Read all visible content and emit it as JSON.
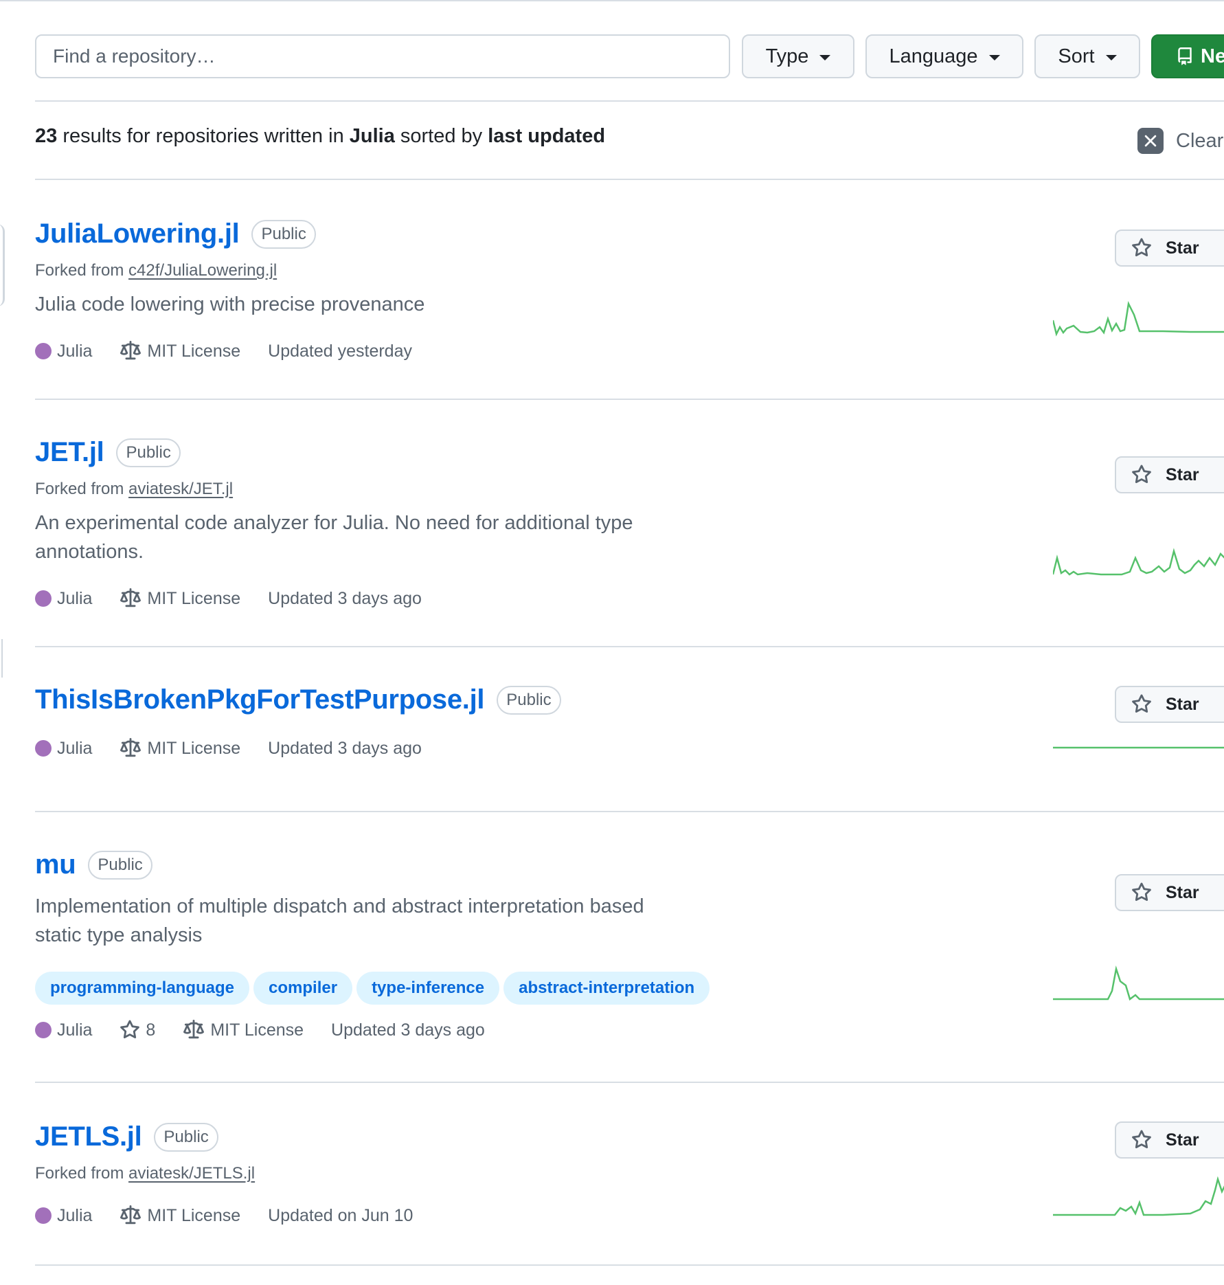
{
  "filter_bar": {
    "search_placeholder": "Find a repository…",
    "type_label": "Type",
    "language_label": "Language",
    "sort_label": "Sort",
    "new_label": "New"
  },
  "results": {
    "count": "23",
    "text1": " results for repositories written in ",
    "language": "Julia",
    "text2": " sorted by ",
    "sort": "last updated",
    "clear_label": "Clear"
  },
  "star_label": "Star",
  "colors": {
    "julia_lang": "#a270ba",
    "link": "#0969da",
    "spark": "#56c16b",
    "new_button": "#1f883d"
  },
  "repos": [
    {
      "name": "JuliaLowering.jl",
      "visibility": "Public",
      "forked_prefix": "Forked from ",
      "forked_from": "c42f/JuliaLowering.jl",
      "description": "Julia code lowering with precise provenance",
      "language": "Julia",
      "license": "MIT License",
      "updated": "Updated yesterday"
    },
    {
      "name": "JET.jl",
      "visibility": "Public",
      "forked_prefix": "Forked from ",
      "forked_from": "aviatesk/JET.jl",
      "description": "An experimental code analyzer for Julia. No need for additional type annotations.",
      "language": "Julia",
      "license": "MIT License",
      "updated": "Updated 3 days ago"
    },
    {
      "name": "ThisIsBrokenPkgForTestPurpose.jl",
      "visibility": "Public",
      "language": "Julia",
      "license": "MIT License",
      "updated": "Updated 3 days ago"
    },
    {
      "name": "mu",
      "visibility": "Public",
      "description": "Implementation of multiple dispatch and abstract interpretation based static type analysis",
      "topics": [
        "programming-language",
        "compiler",
        "type-inference",
        "abstract-interpretation"
      ],
      "language": "Julia",
      "stars": "8",
      "license": "MIT License",
      "updated": "Updated 3 days ago"
    },
    {
      "name": "JETLS.jl",
      "visibility": "Public",
      "forked_prefix": "Forked from ",
      "forked_from": "aviatesk/JETLS.jl",
      "language": "Julia",
      "license": "MIT License",
      "updated": "Updated on Jun 10"
    }
  ]
}
